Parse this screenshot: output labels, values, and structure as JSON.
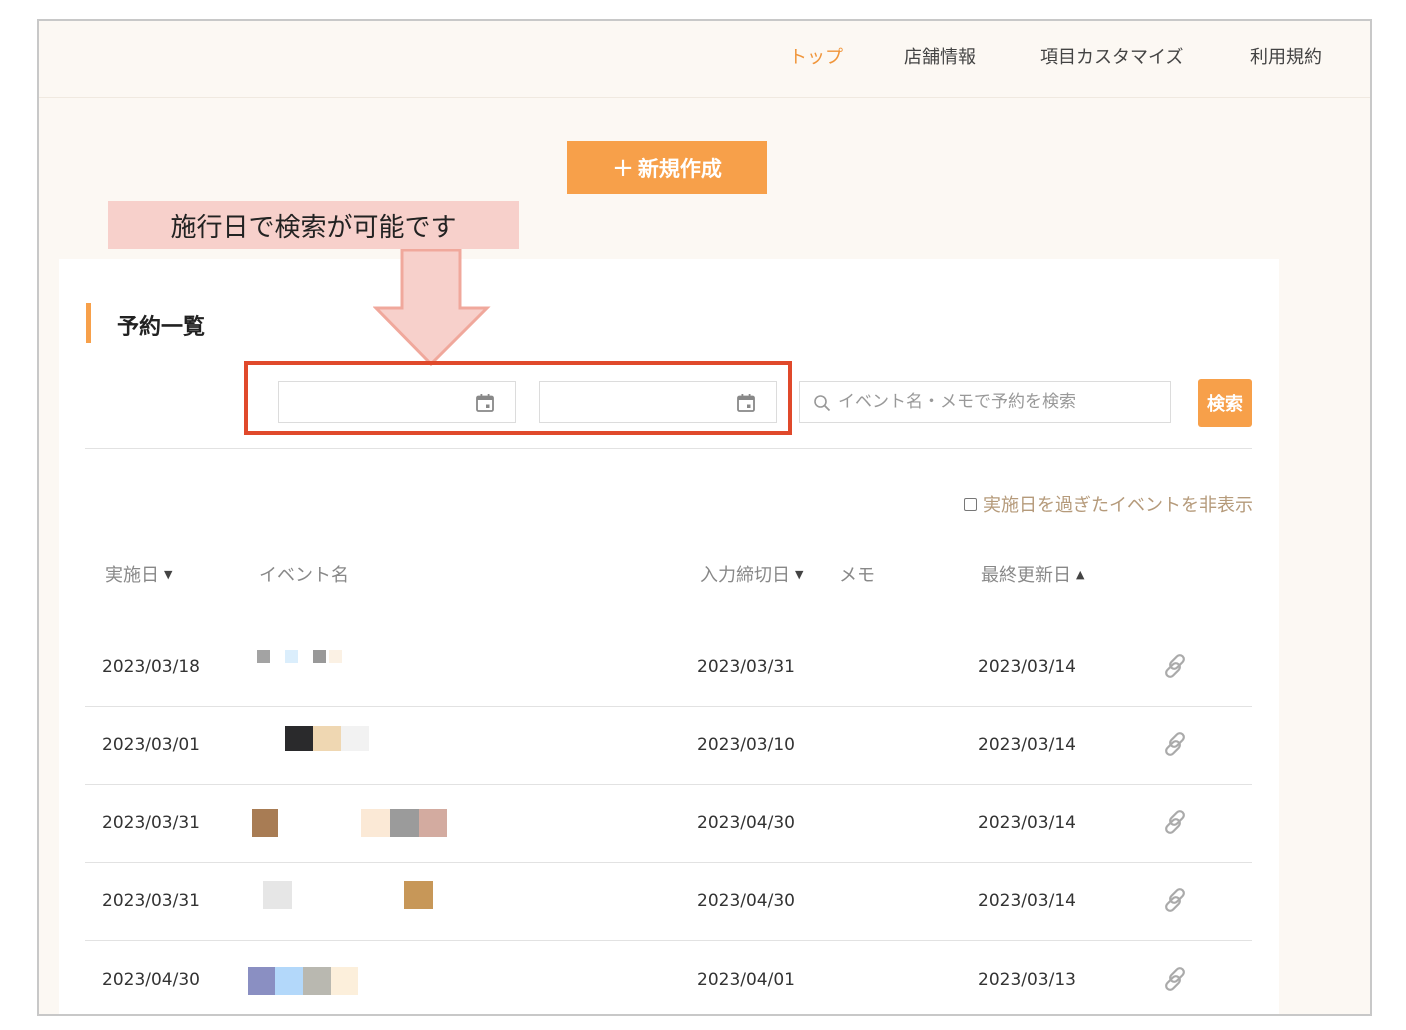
{
  "nav": {
    "items": [
      {
        "label": "トップ",
        "active": true
      },
      {
        "label": "店舗情報",
        "active": false
      },
      {
        "label": "項目カスタマイズ",
        "active": false
      },
      {
        "label": "利用規約",
        "active": false
      }
    ]
  },
  "new_button": {
    "plus": "+",
    "label": "新規作成"
  },
  "callout": {
    "text": "施行日で検索が可能です"
  },
  "section": {
    "title": "予約一覧"
  },
  "filters": {
    "start_date_value": "",
    "end_date_value": "",
    "search_placeholder": "イベント名・メモで予約を検索",
    "search_button": "検索",
    "hide_past_label": "実施日を過ぎたイベントを非表示",
    "hide_past_checked": false
  },
  "table": {
    "headers": {
      "date": "実施日",
      "event": "イベント名",
      "deadline": "入力締切日",
      "memo": "メモ",
      "updated": "最終更新日"
    },
    "rows": [
      {
        "date": "2023/03/18",
        "deadline": "2023/03/31",
        "memo": "",
        "updated": "2023/03/14"
      },
      {
        "date": "2023/03/01",
        "deadline": "2023/03/10",
        "memo": "",
        "updated": "2023/03/14"
      },
      {
        "date": "2023/03/31",
        "deadline": "2023/04/30",
        "memo": "",
        "updated": "2023/03/14"
      },
      {
        "date": "2023/03/31",
        "deadline": "2023/04/30",
        "memo": "",
        "updated": "2023/03/14"
      },
      {
        "date": "2023/04/30",
        "deadline": "2023/04/01",
        "memo": "",
        "updated": "2023/03/13"
      }
    ]
  },
  "colors": {
    "accent": "#f7a04a",
    "nav_active": "#f0953a",
    "highlight_border": "#e0492b",
    "callout_bg": "#f7d0cb",
    "page_bg": "#fcf8f3"
  },
  "icons": [
    "calendar-icon",
    "search-icon",
    "link-icon",
    "checkbox-icon",
    "sort-caret-icon"
  ]
}
